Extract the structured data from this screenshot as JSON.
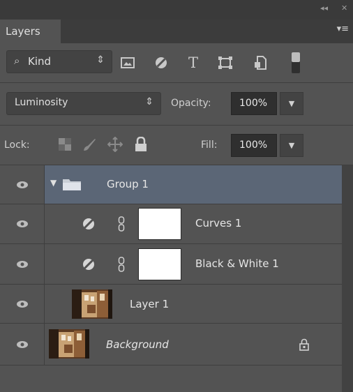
{
  "panel": {
    "tab_label": "Layers",
    "collapse_glyph": "◂◂",
    "close_glyph": "✕",
    "menu_glyph": "▾≡"
  },
  "filter": {
    "kind_label": "Kind",
    "icons": [
      "image-filter-icon",
      "adjustment-filter-icon",
      "type-filter-icon",
      "shape-filter-icon",
      "smart-object-filter-icon"
    ]
  },
  "blend": {
    "mode": "Luminosity",
    "opacity_label": "Opacity:",
    "opacity_value": "100%"
  },
  "lock": {
    "label": "Lock:",
    "fill_label": "Fill:",
    "fill_value": "100%"
  },
  "layers": [
    {
      "name": "Group 1",
      "type": "group",
      "selected": true
    },
    {
      "name": "Curves 1",
      "type": "adjustment"
    },
    {
      "name": "Black & White 1",
      "type": "adjustment"
    },
    {
      "name": "Layer 1",
      "type": "pixel"
    },
    {
      "name": "Background",
      "type": "background",
      "locked": true
    }
  ],
  "colors": {
    "panel_bg": "#535353",
    "selected_row": "#5b6676",
    "field_bg": "#2f2f2f"
  }
}
